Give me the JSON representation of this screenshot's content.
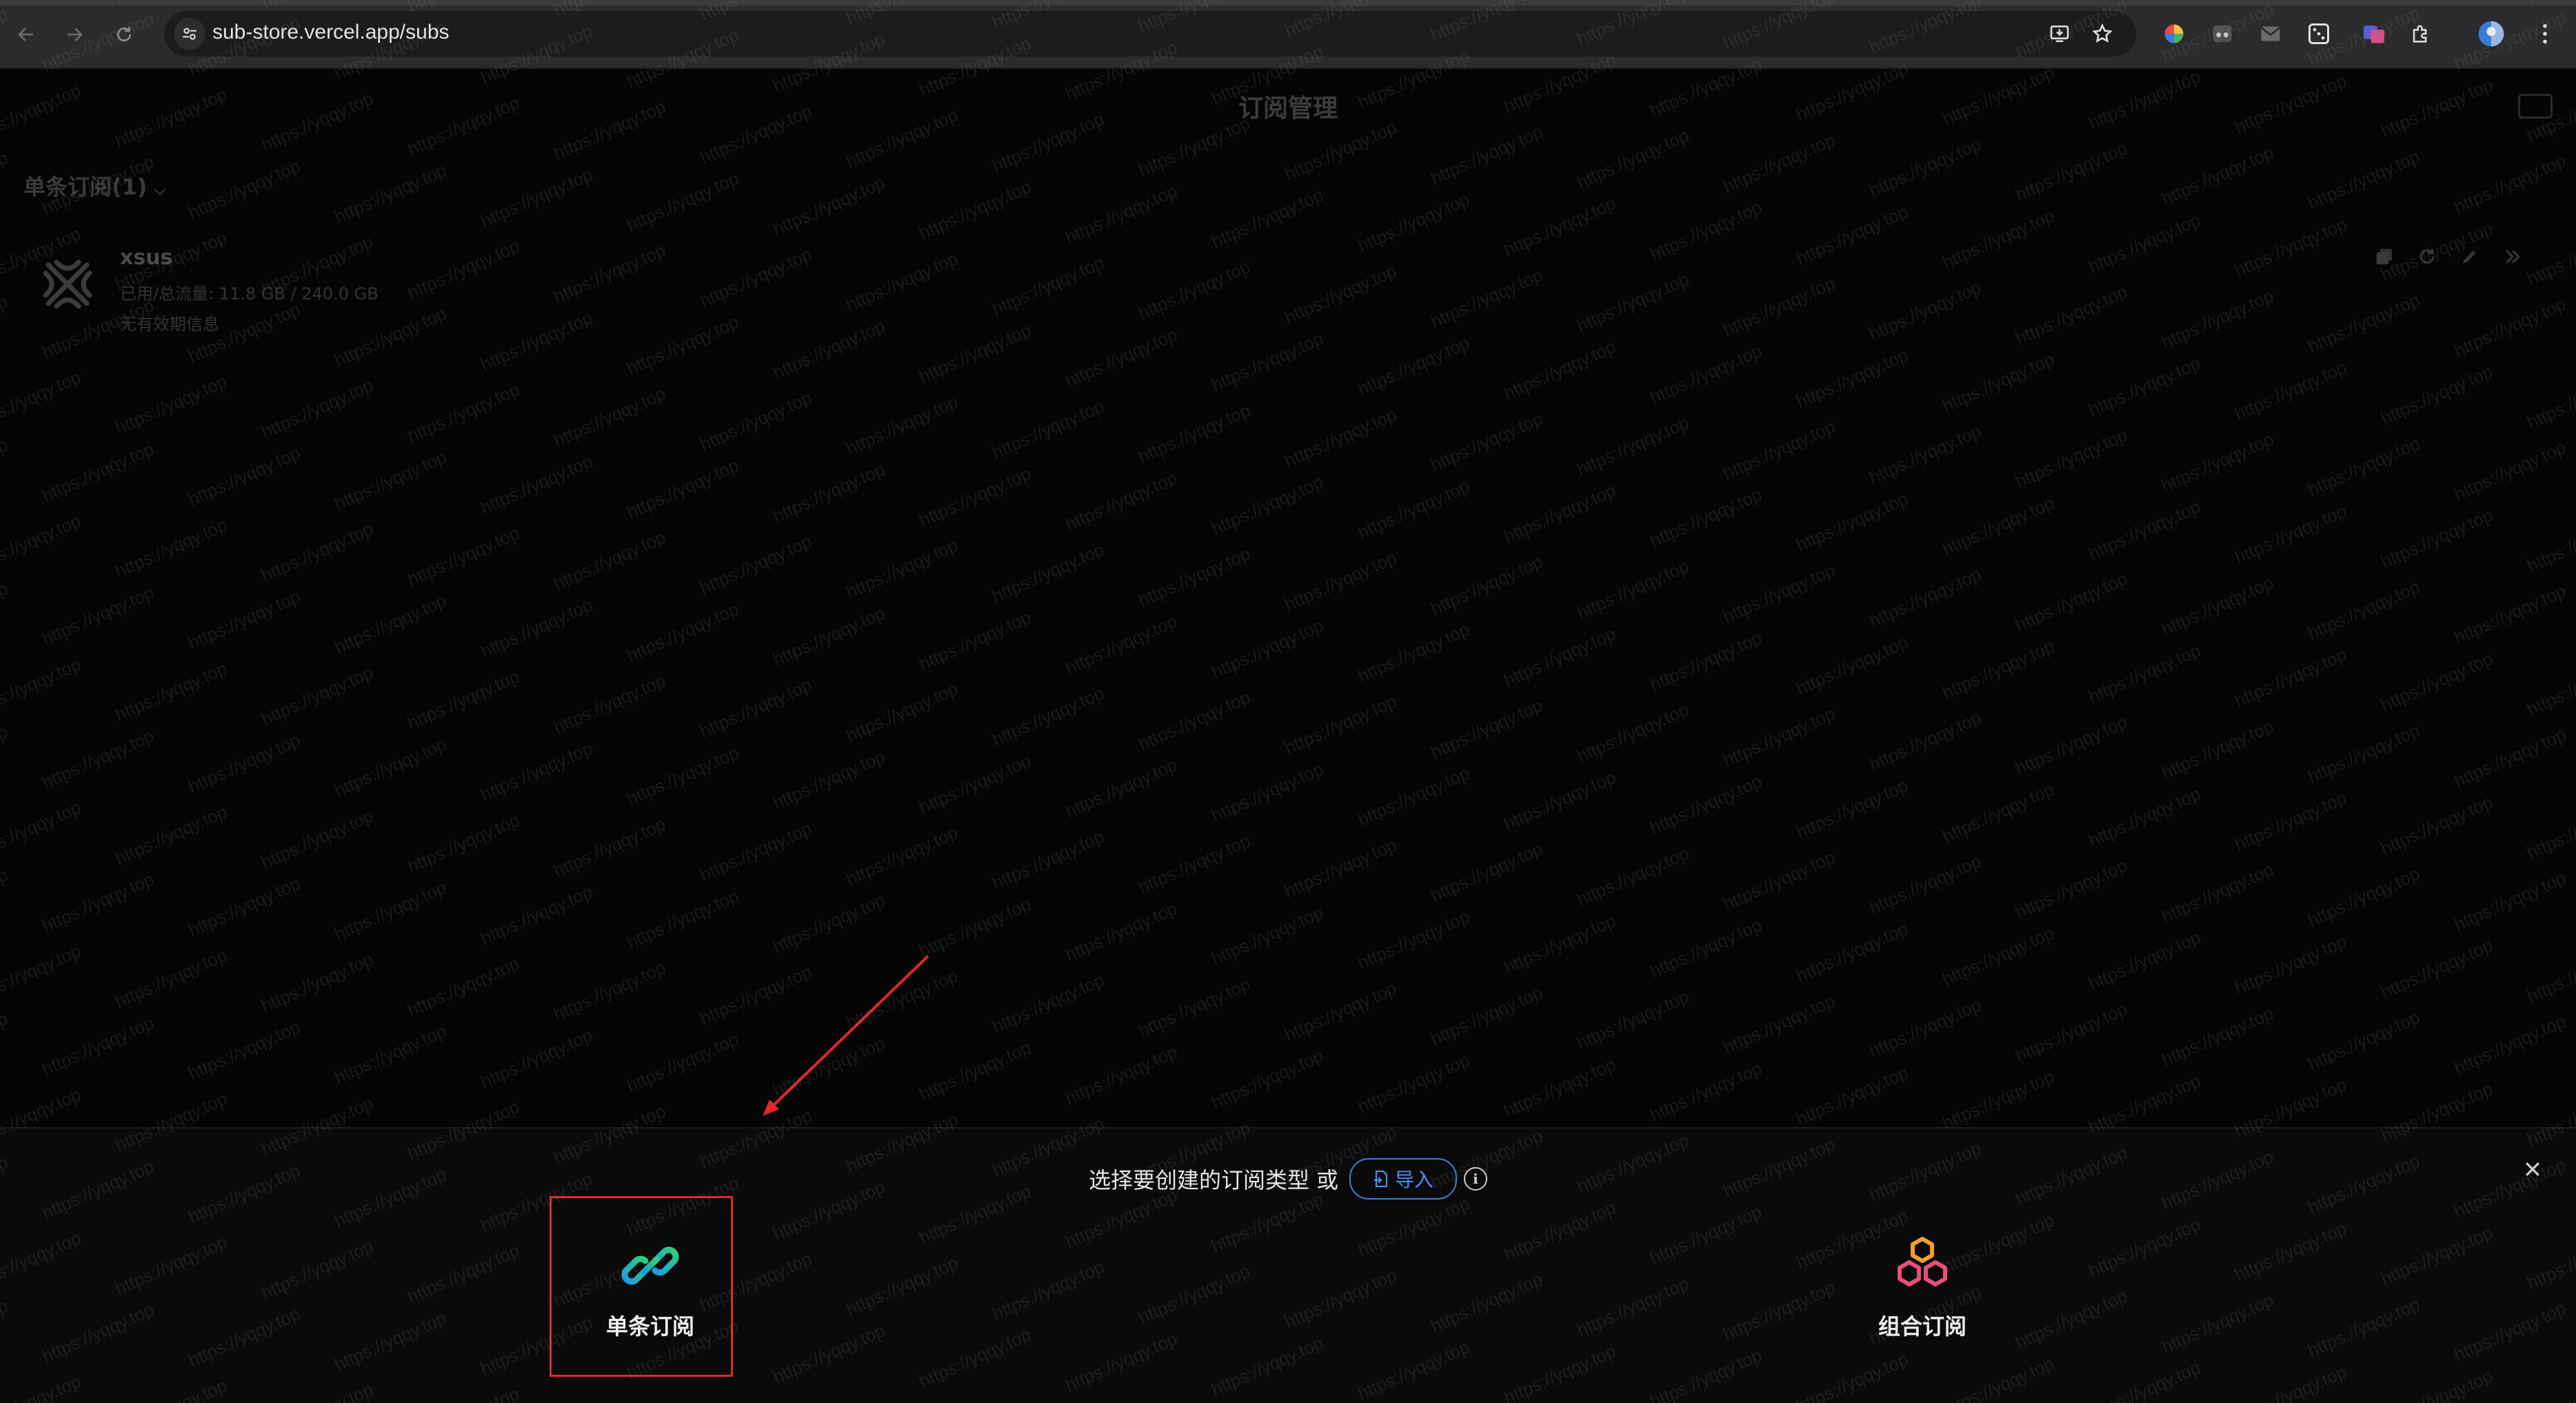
{
  "browser": {
    "url": "sub-store.vercel.app/subs",
    "nav_icons": [
      "back-arrow-icon",
      "forward-arrow-icon",
      "reload-icon"
    ],
    "omnibox_icons": [
      "install-app-icon",
      "bookmark-star-icon"
    ],
    "extensions": [
      "color-wheel-extension-icon",
      "incognito-extension-icon",
      "mail-extension-icon",
      "dice-extension-icon",
      "translate-extension-icon",
      "puzzle-extensions-icon",
      "profile-avatar",
      "more-menu-icon"
    ]
  },
  "app": {
    "title": "订阅管理",
    "section_header": "单条订阅(1)",
    "subscription": {
      "name": "xsus",
      "usage": "已用/总流量: 11.8 GB / 240.0 GB",
      "expiry": "无有效期信息"
    }
  },
  "sheet": {
    "prompt": "选择要创建的订阅类型",
    "or": "或",
    "import_label": "导入",
    "options": [
      {
        "label": "单条订阅",
        "icon": "link-icon"
      },
      {
        "label": "组合订阅",
        "icon": "hexagons-icon"
      }
    ]
  },
  "watermark": {
    "text": "https://yqqy.top"
  },
  "colors": {
    "background": "#050505",
    "accent_blue": "#3d7fd6",
    "annotation_red": "#e12828",
    "link_icon_cyan": "#22a8e0",
    "link_icon_green": "#2fd07a",
    "hex_orange": "#f0a030",
    "hex_pink": "#e8507a"
  }
}
